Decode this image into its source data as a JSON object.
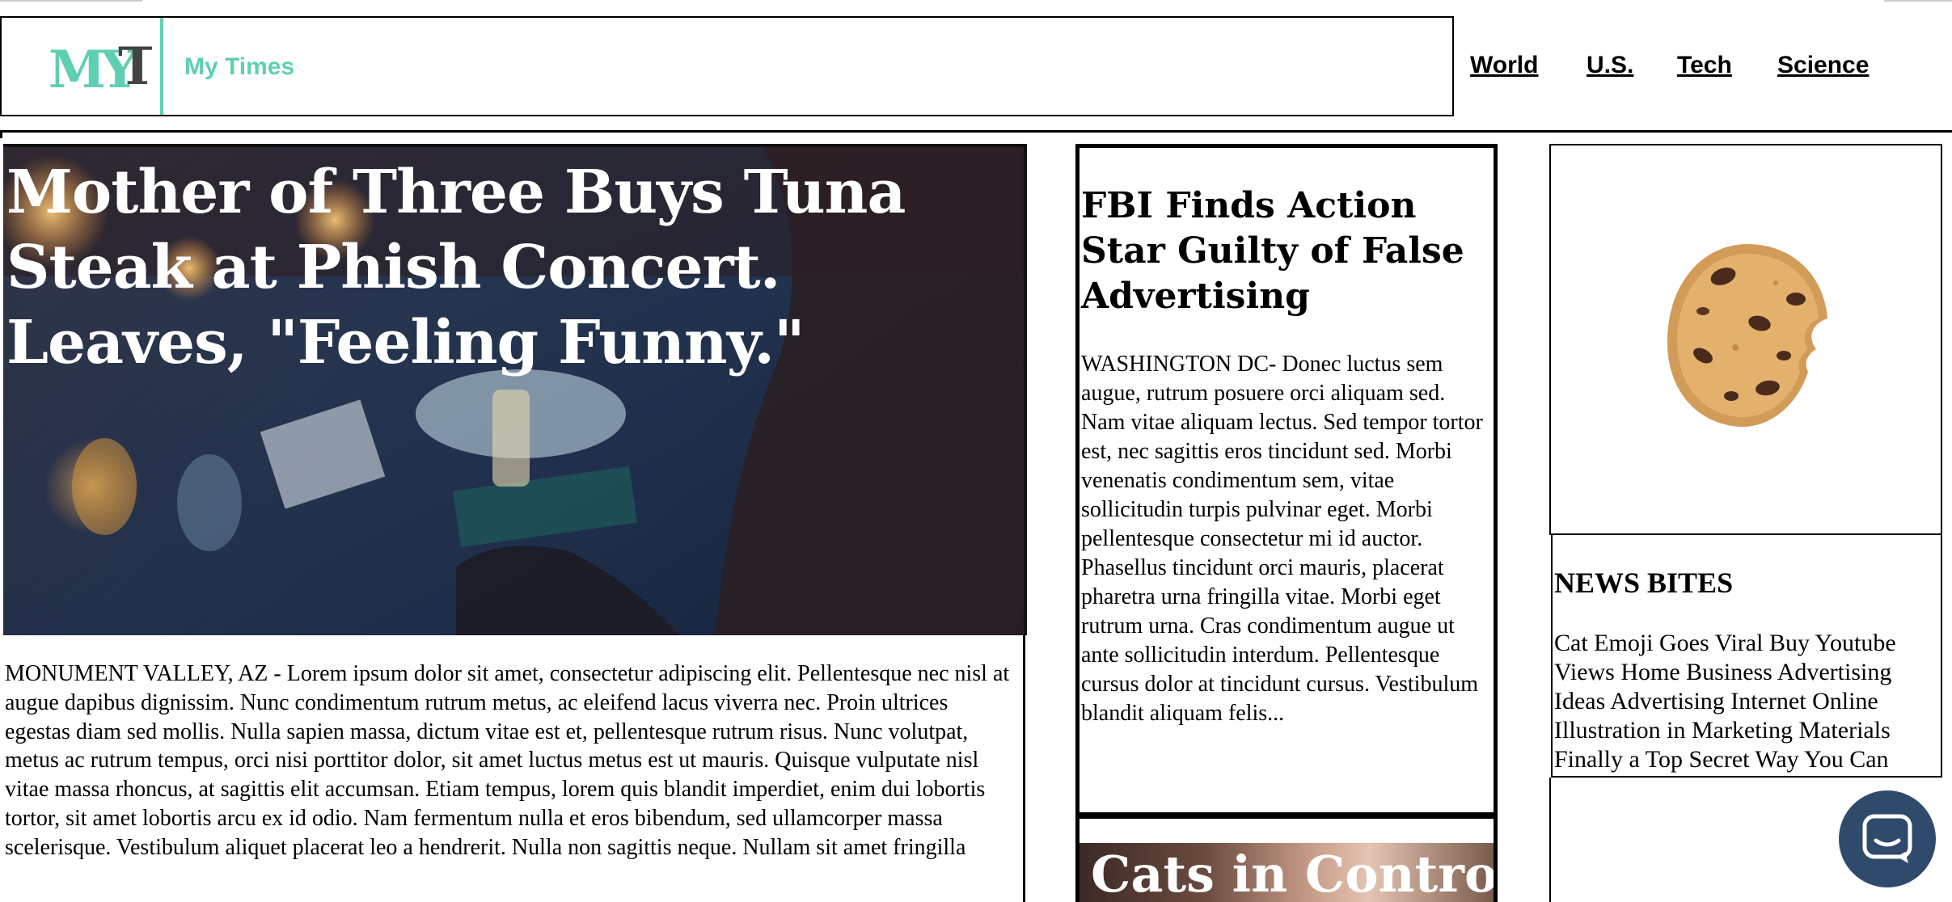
{
  "header": {
    "logo_text": "MYT",
    "site_name": "My Times",
    "nav": [
      "World",
      "U.S.",
      "Tech",
      "Science"
    ]
  },
  "main_story": {
    "headline": "Mother of Three Buys Tuna Steak at Phish Concert. Leaves, \"Feeling Funny.\"",
    "body": "MONUMENT VALLEY, AZ - Lorem ipsum dolor sit amet, consectetur adipiscing elit. Pellentesque nec nisl at augue dapibus dignissim. Nunc condimentum rutrum metus, ac eleifend lacus viverra nec. Proin ultrices egestas diam sed mollis. Nulla sapien massa, dictum vitae est et, pellentesque rutrum risus. Nunc volutpat, metus ac rutrum tempus, orci nisi porttitor dolor, sit amet luctus metus est ut mauris. Quisque vulputate nisl vitae massa rhoncus, at sagittis elit accumsan. Etiam tempus, lorem quis blandit imperdiet, enim dui lobortis tortor, sit amet lobortis arcu ex id odio. Nam fermentum nulla et eros bibendum, sed ullamcorper massa scelerisque. Vestibulum aliquet placerat leo a hendrerit. Nulla non sagittis neque. Nullam sit amet fringilla"
  },
  "side_story": {
    "headline": "FBI Finds Action Star Guilty of False Advertising",
    "body": "WASHINGTON DC- Donec luctus sem augue, rutrum posuere orci aliquam sed. Nam vitae aliquam lectus. Sed tempor tortor est, nec sagittis eros tincidunt sed. Morbi venenatis condimentum sem, vitae sollicitudin turpis pulvinar eget. Morbi pellentesque consectetur mi id auctor. Phasellus tincidunt orci mauris, placerat pharetra urna fringilla vitae. Morbi eget rutrum urna. Cras condimentum augue ut ante sollicitudin interdum. Pellentesque cursus dolor at tincidunt cursus. Vestibulum blandit aliquam felis..."
  },
  "side_story_2": {
    "headline": "Cats in Control-"
  },
  "news_bites": {
    "title": "NEWS BITES",
    "text": "Cat Emoji Goes Viral Buy Youtube Views Home Business Advertising Ideas Advertising Internet Online Illustration in Marketing Materials Finally a Top Secret Way You Can"
  },
  "colors": {
    "brand": "#5fcfb2",
    "chat_button": "#2f4a6b"
  },
  "icons": {
    "ad": "cookie-icon",
    "chat": "chat-bubble-icon"
  }
}
